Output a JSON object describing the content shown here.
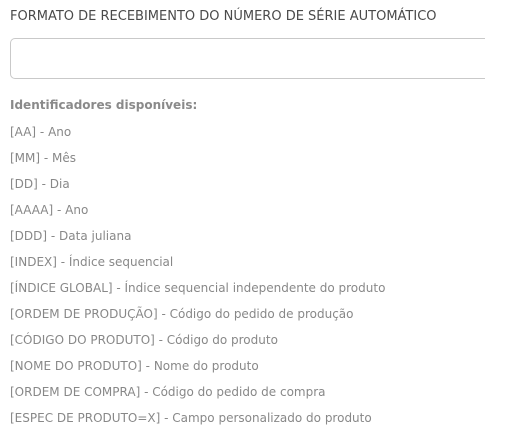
{
  "form": {
    "label": "FORMATO DE RECEBIMENTO DO NÚMERO DE SÉRIE AUTOMÁTICO",
    "input_value": ""
  },
  "help": {
    "title": "Identificadores disponíveis:",
    "items": [
      "[AA] - Ano",
      "[MM] - Mês",
      "[DD] - Dia",
      "[AAAA] - Ano",
      "[DDD] - Data juliana",
      "[INDEX] - Índice sequencial",
      "[ÍNDICE GLOBAL] - Índice sequencial independente do produto",
      "[ORDEM DE PRODUÇÃO] - Código do pedido de produção",
      "[CÓDIGO DO PRODUTO] - Código do produto",
      "[NOME DO PRODUTO] - Nome do produto",
      "[ORDEM DE COMPRA] - Código do pedido de compra",
      "[ESPEC DE PRODUTO=X] - Campo personalizado do produto"
    ]
  }
}
